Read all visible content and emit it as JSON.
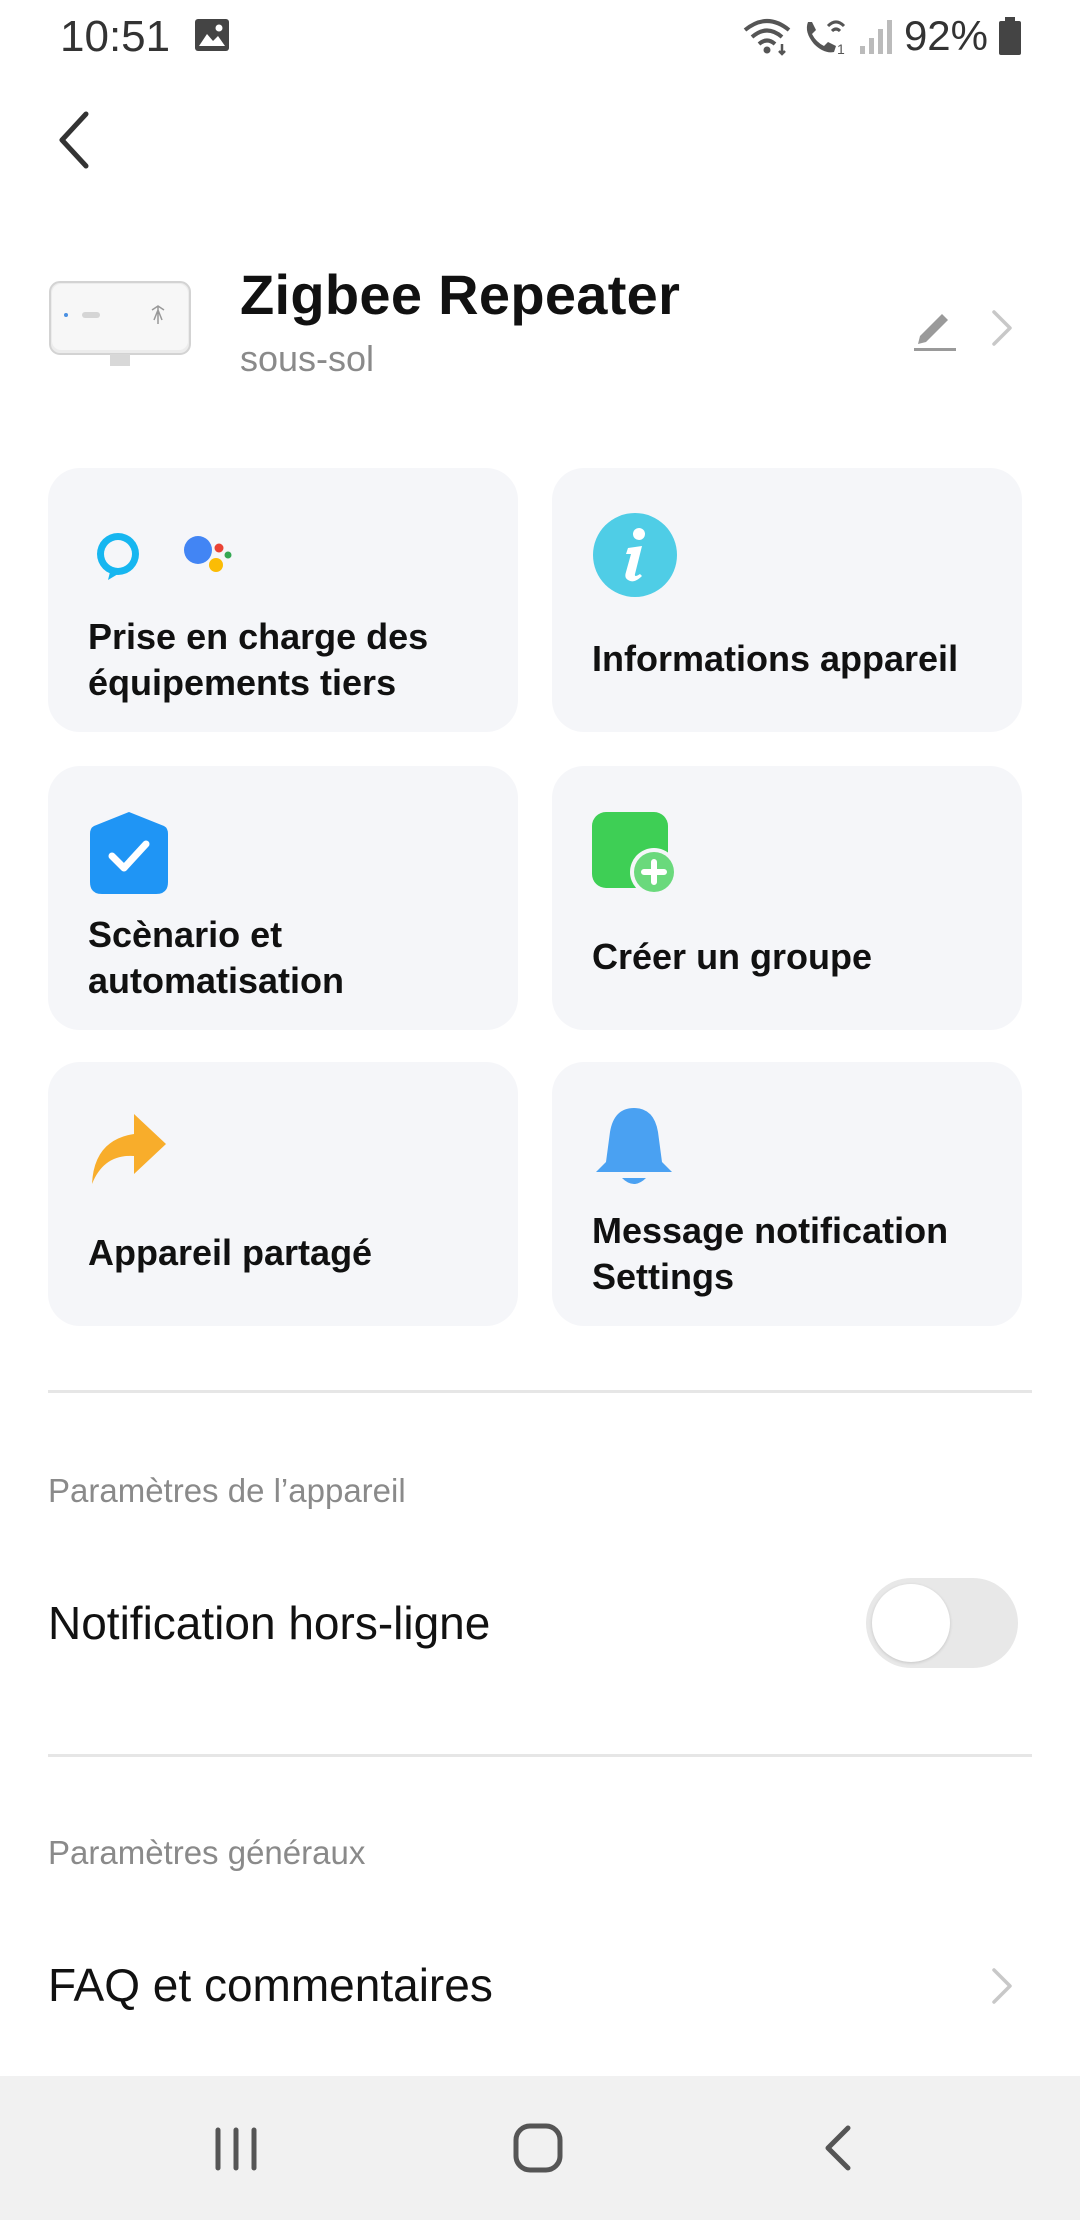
{
  "status_bar": {
    "time": "10:51",
    "battery_percent": "92%",
    "icons": [
      "gallery-icon",
      "wifi-icon",
      "wifi-calling-icon",
      "signal-icon",
      "battery-icon"
    ]
  },
  "header": {
    "device_name": "Zigbee Repeater",
    "room": "sous-sol"
  },
  "cards": [
    {
      "label": "Prise en charge des équipements tiers",
      "icon": "alexa-google-assistant-icon"
    },
    {
      "label": "Informations appareil",
      "icon": "info-icon"
    },
    {
      "label": "Scènario et automatisation",
      "icon": "automation-check-icon"
    },
    {
      "label": "Créer un groupe",
      "icon": "create-group-icon"
    },
    {
      "label": "Appareil partagé",
      "icon": "share-arrow-icon"
    },
    {
      "label": "Message notification Settings",
      "icon": "bell-icon"
    }
  ],
  "device_settings": {
    "section_title": "Paramètres de l’appareil",
    "offline_notification_label": "Notification hors-ligne",
    "offline_notification_enabled": false
  },
  "general_settings": {
    "section_title": "Paramètres généraux",
    "faq_label": "FAQ et commentaires"
  },
  "colors": {
    "card_bg": "#f5f6f9",
    "info_cyan": "#4fcde6",
    "automation_blue": "#1f95f5",
    "group_green": "#3ecf55",
    "share_orange": "#f8ad2b",
    "bell_blue": "#4aa1f2"
  }
}
